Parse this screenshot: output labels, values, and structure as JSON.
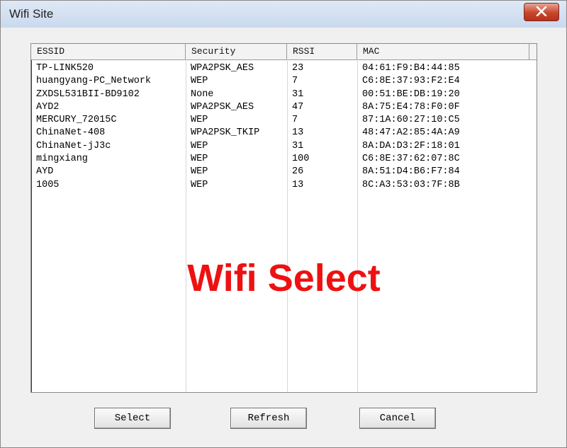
{
  "window": {
    "title": "Wifi Site"
  },
  "table": {
    "columns": [
      "ESSID",
      "Security",
      "RSSI",
      "MAC"
    ],
    "rows": [
      [
        "TP-LINK520",
        "WPA2PSK_AES",
        "23",
        "04:61:F9:B4:44:85"
      ],
      [
        "huangyang-PC_Network",
        "WEP",
        "7",
        "C6:8E:37:93:F2:E4"
      ],
      [
        "ZXDSL531BII-BD9102",
        "None",
        "31",
        "00:51:BE:DB:19:20"
      ],
      [
        "AYD2",
        "WPA2PSK_AES",
        "47",
        "8A:75:E4:78:F0:0F"
      ],
      [
        "MERCURY_72015C",
        "WEP",
        "7",
        "87:1A:60:27:10:C5"
      ],
      [
        "ChinaNet-408",
        "WPA2PSK_TKIP",
        "13",
        "48:47:A2:85:4A:A9"
      ],
      [
        "ChinaNet-jJ3c",
        "WEP",
        "31",
        "8A:DA:D3:2F:18:01"
      ],
      [
        "mingxiang",
        "WEP",
        "100",
        "C6:8E:37:62:07:8C"
      ],
      [
        "AYD",
        "WEP",
        "26",
        "8A:51:D4:B6:F7:84"
      ],
      [
        "1005",
        "WEP",
        "13",
        "8C:A3:53:03:7F:8B"
      ]
    ]
  },
  "overlay_text": "Wifi Select",
  "buttons": {
    "select": "Select",
    "refresh": "Refresh",
    "cancel": "Cancel"
  },
  "colors": {
    "overlay": "#ee1111",
    "close_button": "#c8452d"
  },
  "icons": {
    "close": "close-icon"
  }
}
